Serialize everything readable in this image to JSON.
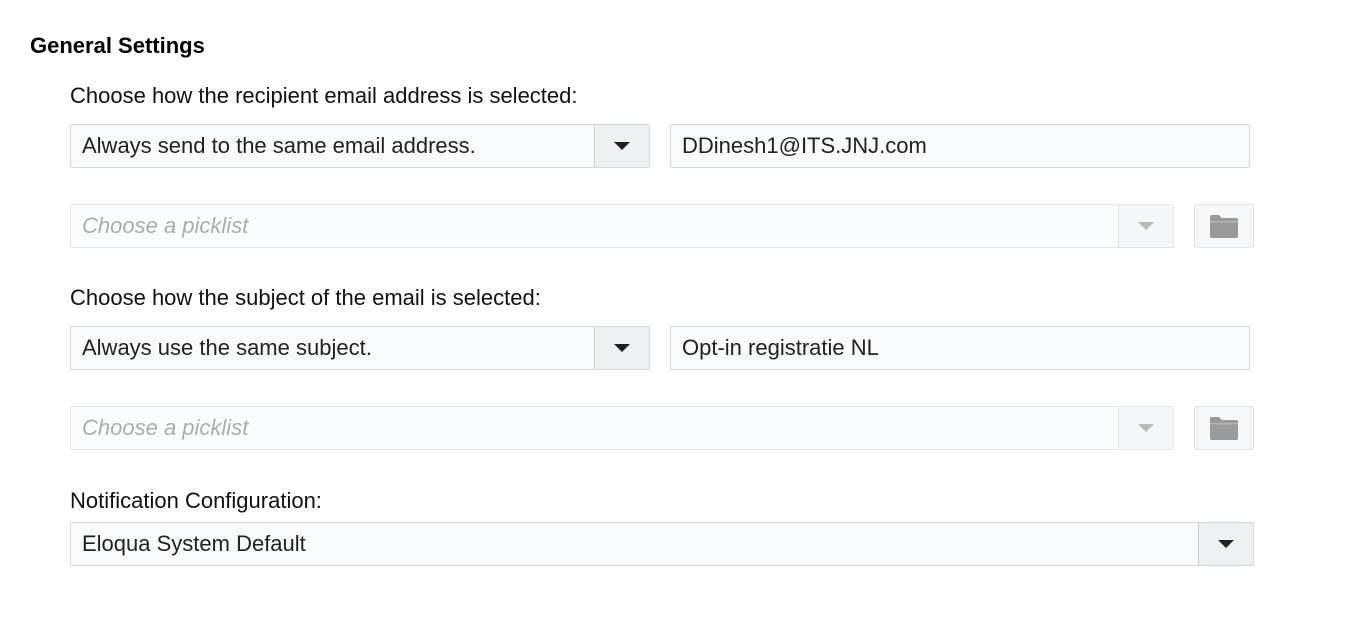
{
  "section": {
    "title": "General Settings"
  },
  "recipient": {
    "label": "Choose how the recipient email address is selected:",
    "mode_value": "Always send to the same email address.",
    "email_value": "DDinesh1@ITS.JNJ.com",
    "picklist_placeholder": "Choose a picklist"
  },
  "subject": {
    "label": "Choose how the subject of the email is selected:",
    "mode_value": "Always use the same subject.",
    "subject_value": "Opt-in registratie NL",
    "picklist_placeholder": "Choose a picklist"
  },
  "notification": {
    "label": "Notification Configuration:",
    "value": "Eloqua System Default"
  },
  "icons": {
    "dropdown": "chevron-down-icon",
    "browse": "folder-icon"
  },
  "colors": {
    "field_background": "#f8fafc",
    "field_border": "#d4d8dc",
    "placeholder_text": "#a9adb1",
    "folder_icon": "#9a9a9a"
  }
}
